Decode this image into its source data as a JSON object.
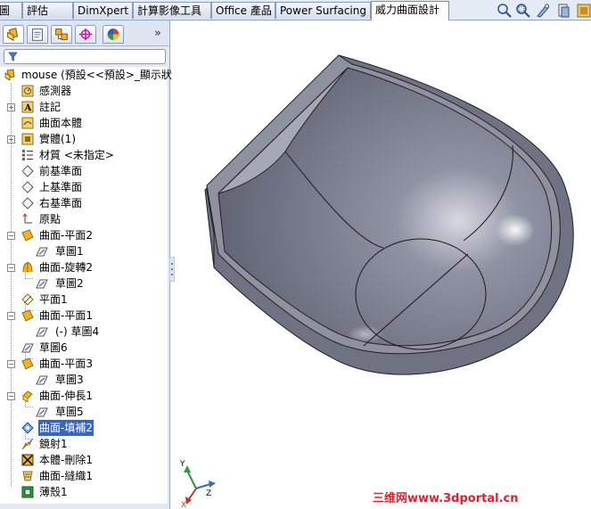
{
  "tabs": [
    "圖",
    "評估",
    "DimXpert",
    "計算影像工具",
    "Office 產品",
    "Power Surfacing",
    "威力曲面設計"
  ],
  "active_tab_index": 6,
  "toolbar_icons": [
    "zoom-to-fit-icon",
    "zoom-area-icon",
    "view-tools-icon",
    "view-cube-icon",
    "display-style-icon"
  ],
  "panel_tabs": [
    "featuremanager-icon",
    "propertymanager-icon",
    "configurationmanager-icon",
    "dimxpertmanager-icon",
    "displaymanager-icon"
  ],
  "panel_more": "»",
  "tree": {
    "root": "mouse  (預設<<預設>_顯示狀",
    "items": [
      "感測器",
      "註記",
      "曲面本體",
      "實體(1)",
      "材質 <未指定>",
      "前基準面",
      "上基準面",
      "右基準面",
      "原點",
      "曲面-平面2",
      "草圖1",
      "曲面-旋轉2",
      "草圖2",
      "平面1",
      "曲面-平面1",
      "(-) 草圖4",
      "草圖6",
      "曲面-平面3",
      "草圖3",
      "曲面-伸長1",
      "草圖5",
      "曲面-填補2",
      "鏡射1",
      "本體-刪除1",
      "曲面-縫織1",
      "薄殼1"
    ]
  },
  "triad": {
    "x": "X",
    "y": "Y",
    "z": "Z"
  },
  "watermark": "三维网www.3dportal.cn",
  "colors": {
    "model": "#7a7f8f",
    "selection": "#3a64c4",
    "watermark": "#e0202a"
  }
}
